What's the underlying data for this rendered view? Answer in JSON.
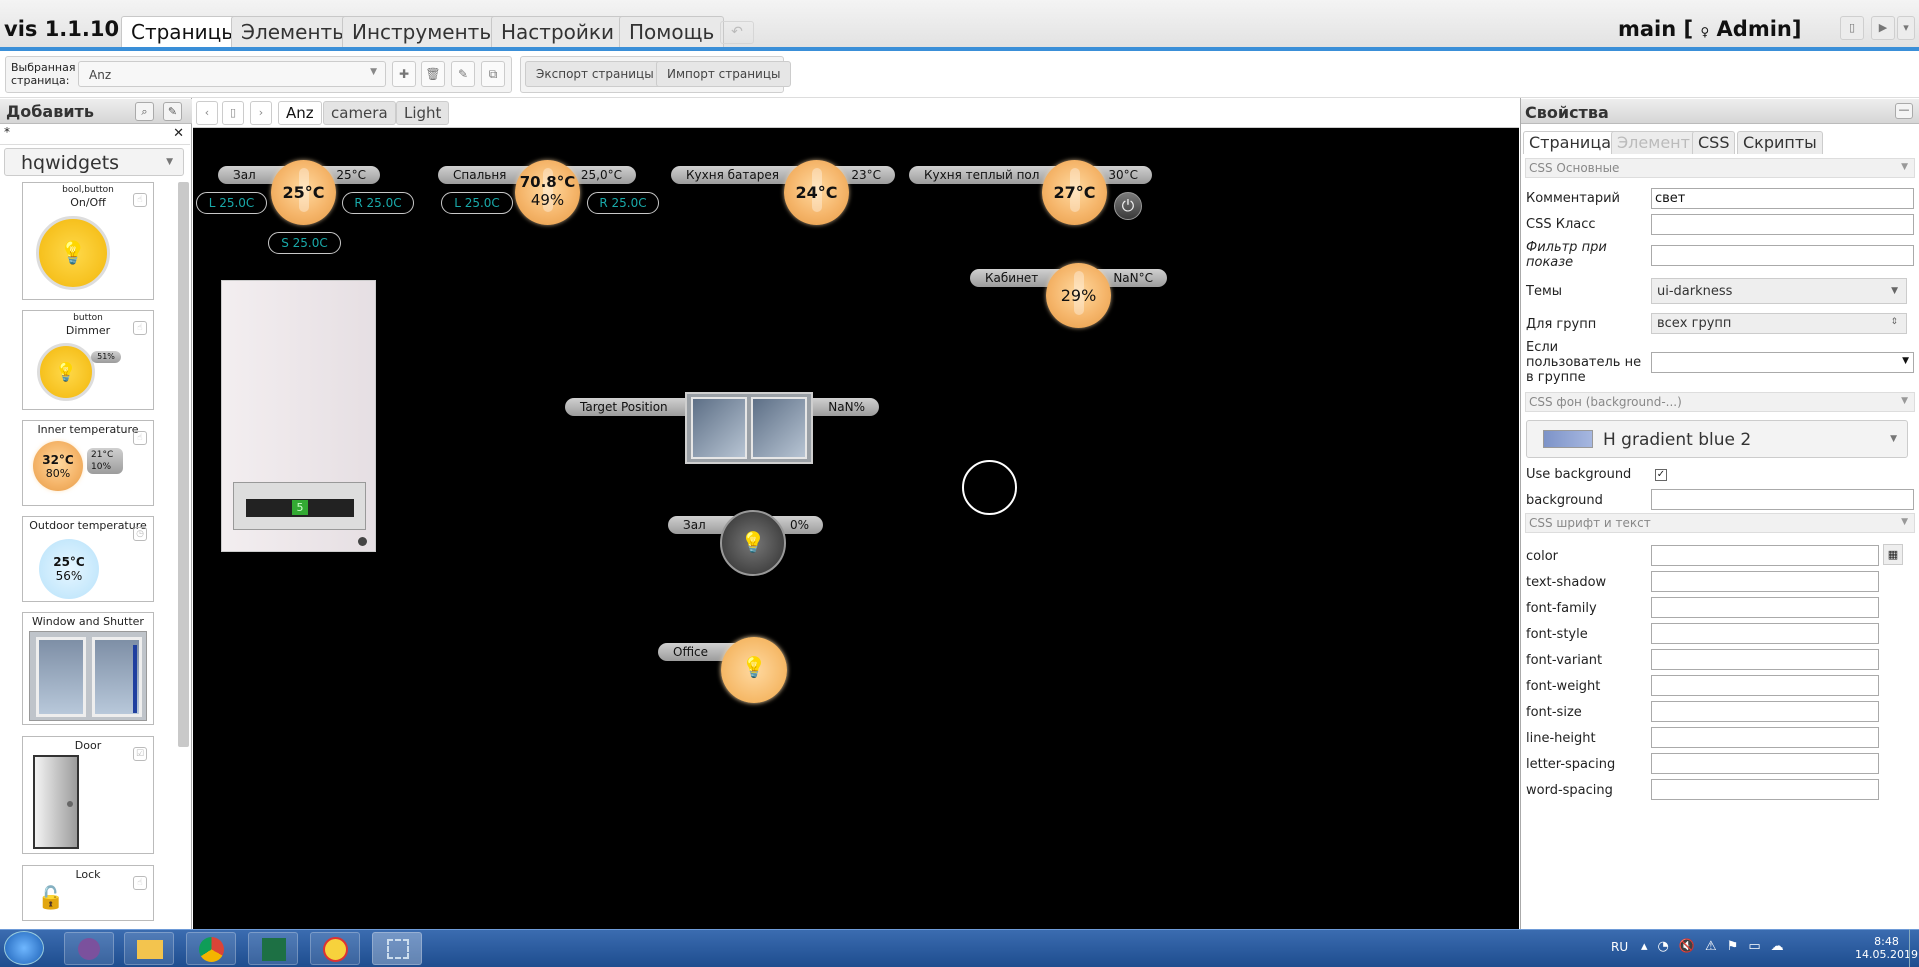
{
  "app": {
    "brand": "vis 1.1.10",
    "user_label": "main [",
    "user_name": "Admin]"
  },
  "menu": {
    "tabs": [
      "Страницы",
      "Элементы",
      "Инструменты",
      "Настройки",
      "Помощь"
    ],
    "undo": "↶"
  },
  "toolbar": {
    "page_label_1": "Выбранная",
    "page_label_2": "страница:",
    "selected_page": "Anz",
    "export": "Экспорт страницы",
    "import": "Импорт страницы"
  },
  "left": {
    "title": "Добавить",
    "filter": "*",
    "set": "hqwidgets",
    "widgets": [
      {
        "line1": "bool,button",
        "line2": "On/Off"
      },
      {
        "line1": "button",
        "line2": "Dimmer",
        "pct": "51%"
      },
      {
        "line1": "Inner temperature",
        "temp": "32°C",
        "hum": "80%",
        "set_t": "21°C",
        "set_h": "10%"
      },
      {
        "line1": "Outdoor temperature",
        "temp": "25°C",
        "hum": "56%"
      },
      {
        "line1": "Window and Shutter"
      },
      {
        "line1": "Door"
      },
      {
        "line1": "Lock"
      }
    ]
  },
  "canvas": {
    "nav": {
      "prev": "‹",
      "del": "▯",
      "next": "›"
    },
    "tabs": [
      "Anz",
      "camera",
      "Light"
    ],
    "zal": {
      "name": "Зал",
      "target": "25°C",
      "temp": "25°C",
      "l": "L 25.0C",
      "r": "R 25.0C",
      "s": "S 25.0C"
    },
    "spalnya": {
      "name": "Спальня",
      "target": "25,0°C",
      "temp": "70.8°C",
      "hum": "49%",
      "l": "L 25.0C",
      "r": "R 25.0C"
    },
    "kitchen_bat": {
      "name": "Кухня батарея",
      "target": "23°C",
      "temp": "24°C"
    },
    "kitchen_floor": {
      "name": "Кухня теплый пол",
      "target": "30°C",
      "temp": "27°C"
    },
    "cabinet": {
      "name": "Кабинет",
      "target": "NaN°C",
      "temp": "29%"
    },
    "boiler": {
      "display": "5"
    },
    "window": {
      "name": "Target Position",
      "value": "NaN%"
    },
    "zal_light": {
      "name": "Зал",
      "value": "0%"
    },
    "office": {
      "name": "Office"
    }
  },
  "props": {
    "title": "Свойства",
    "tabs": [
      "Страница",
      "Элемент",
      "CSS",
      "Скрипты"
    ],
    "sec_basic": "CSS Основные",
    "comment_label": "Комментарий",
    "comment_value": "свет",
    "cssclass_label": "CSS Класс",
    "filter_label_1": "Фильтр при",
    "filter_label_2": "показе",
    "themes_label": "Темы",
    "theme_value": "ui-darkness",
    "groups_label": "Для групп",
    "groups_value": "всех групп",
    "ifnot_1": "Если",
    "ifnot_2": "пользователь не",
    "ifnot_3": "в группе",
    "sec_bg": "CSS фон (background-...)",
    "gradient": "H gradient blue 2",
    "use_bg": "Use background",
    "background": "background",
    "sec_font": "CSS шрифт и текст",
    "font_props": [
      "color",
      "text-shadow",
      "font-family",
      "font-style",
      "font-variant",
      "font-weight",
      "font-size",
      "line-height",
      "letter-spacing",
      "word-spacing"
    ]
  },
  "taskbar": {
    "lang": "RU",
    "time": "8:48",
    "date": "14.05.2019",
    "apps": [
      "viber",
      "explorer",
      "chrome",
      "excel",
      "1c",
      "snipping"
    ]
  }
}
